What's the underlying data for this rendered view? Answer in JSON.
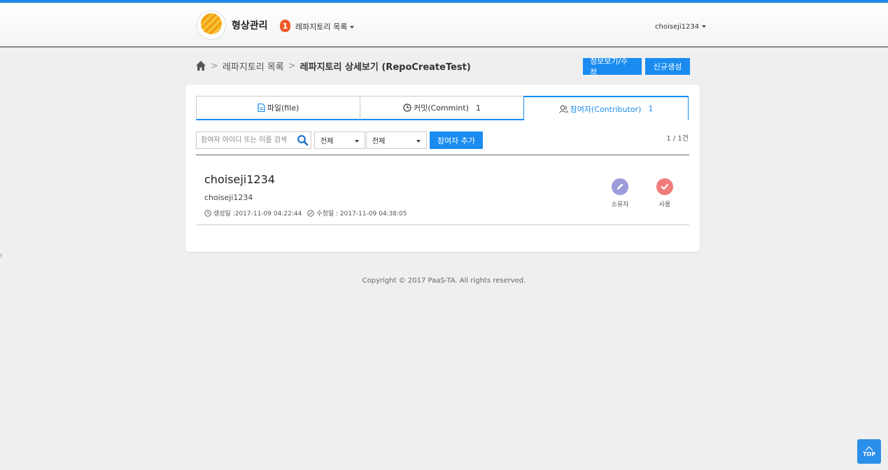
{
  "header": {
    "brand": "형상관리",
    "nav_badge": "1",
    "nav_menu": "레파지토리 목록",
    "user": "choiseji1234"
  },
  "breadcrumb": {
    "home_icon": "home-icon",
    "list": "레파지토리 목록",
    "current": "레파지토리 상세보기 (RepoCreateTest)"
  },
  "actions": {
    "info_edit": "정보보기/수정",
    "create_new": "신규생성"
  },
  "tabs": [
    {
      "label": "파일(file)",
      "icon": "file-icon",
      "count": ""
    },
    {
      "label": "커밋(Commint)",
      "icon": "clock-icon",
      "count": "1"
    },
    {
      "label": "참여자(Contributor)",
      "icon": "users-icon",
      "count": "1"
    }
  ],
  "filters": {
    "search_placeholder": "참여자 아이디 또는 이름 검색",
    "select1": "전체",
    "select2": "전체",
    "add_button": "참여자 추가",
    "count": "1 / 1건"
  },
  "contributors": [
    {
      "name": "choiseji1234",
      "id": "choiseji1234",
      "created": "생성일 :2017-11-09 04:22:44",
      "modified": "수정일 : 2017-11-09 04:38:05",
      "owner_label": "소유자",
      "use_label": "사용"
    }
  ],
  "footer": {
    "copyright": "Copyright © 2017 PaaS-TA. All rights reserved.",
    "side_mark": "f",
    "top_label": "TOP"
  },
  "colors": {
    "accent": "#1a8cf0",
    "badge": "#f05a28",
    "owner": "#9c9cdb",
    "use": "#f07b7b"
  }
}
